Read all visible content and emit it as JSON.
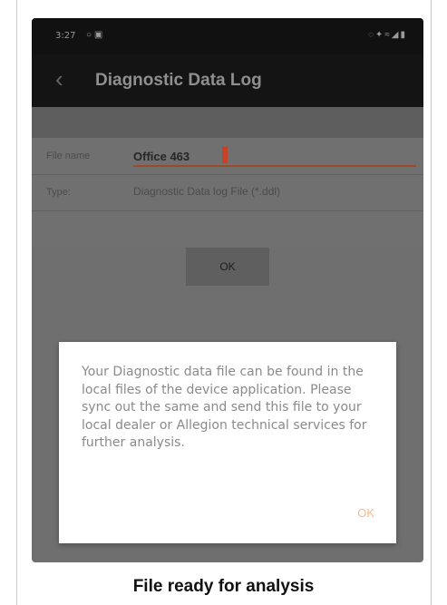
{
  "status_bar": {
    "time": "3:27",
    "left_icons": [
      "notification-icon",
      "gallery-icon"
    ],
    "right_icons": [
      "mute-icon",
      "bluetooth-icon",
      "wifi-icon",
      "signal-icon",
      "battery-icon"
    ]
  },
  "app_bar": {
    "title": "Diagnostic Data Log"
  },
  "form": {
    "file_name_label": "File name",
    "file_name_value": "Office 463",
    "type_label": "Type:",
    "type_value": "Diagnostic Data log File (*.ddl)",
    "ok_label": "OK"
  },
  "dialog": {
    "message": "Your Diagnostic data file can be found in the local files of the device application. Please sync out the same and send this file to your local dealer or Allegion technical services for further analysis.",
    "ok_label": "OK"
  },
  "caption": "File ready for analysis",
  "colors": {
    "accent": "#c84226",
    "dialog_button": "#f2b98e"
  }
}
